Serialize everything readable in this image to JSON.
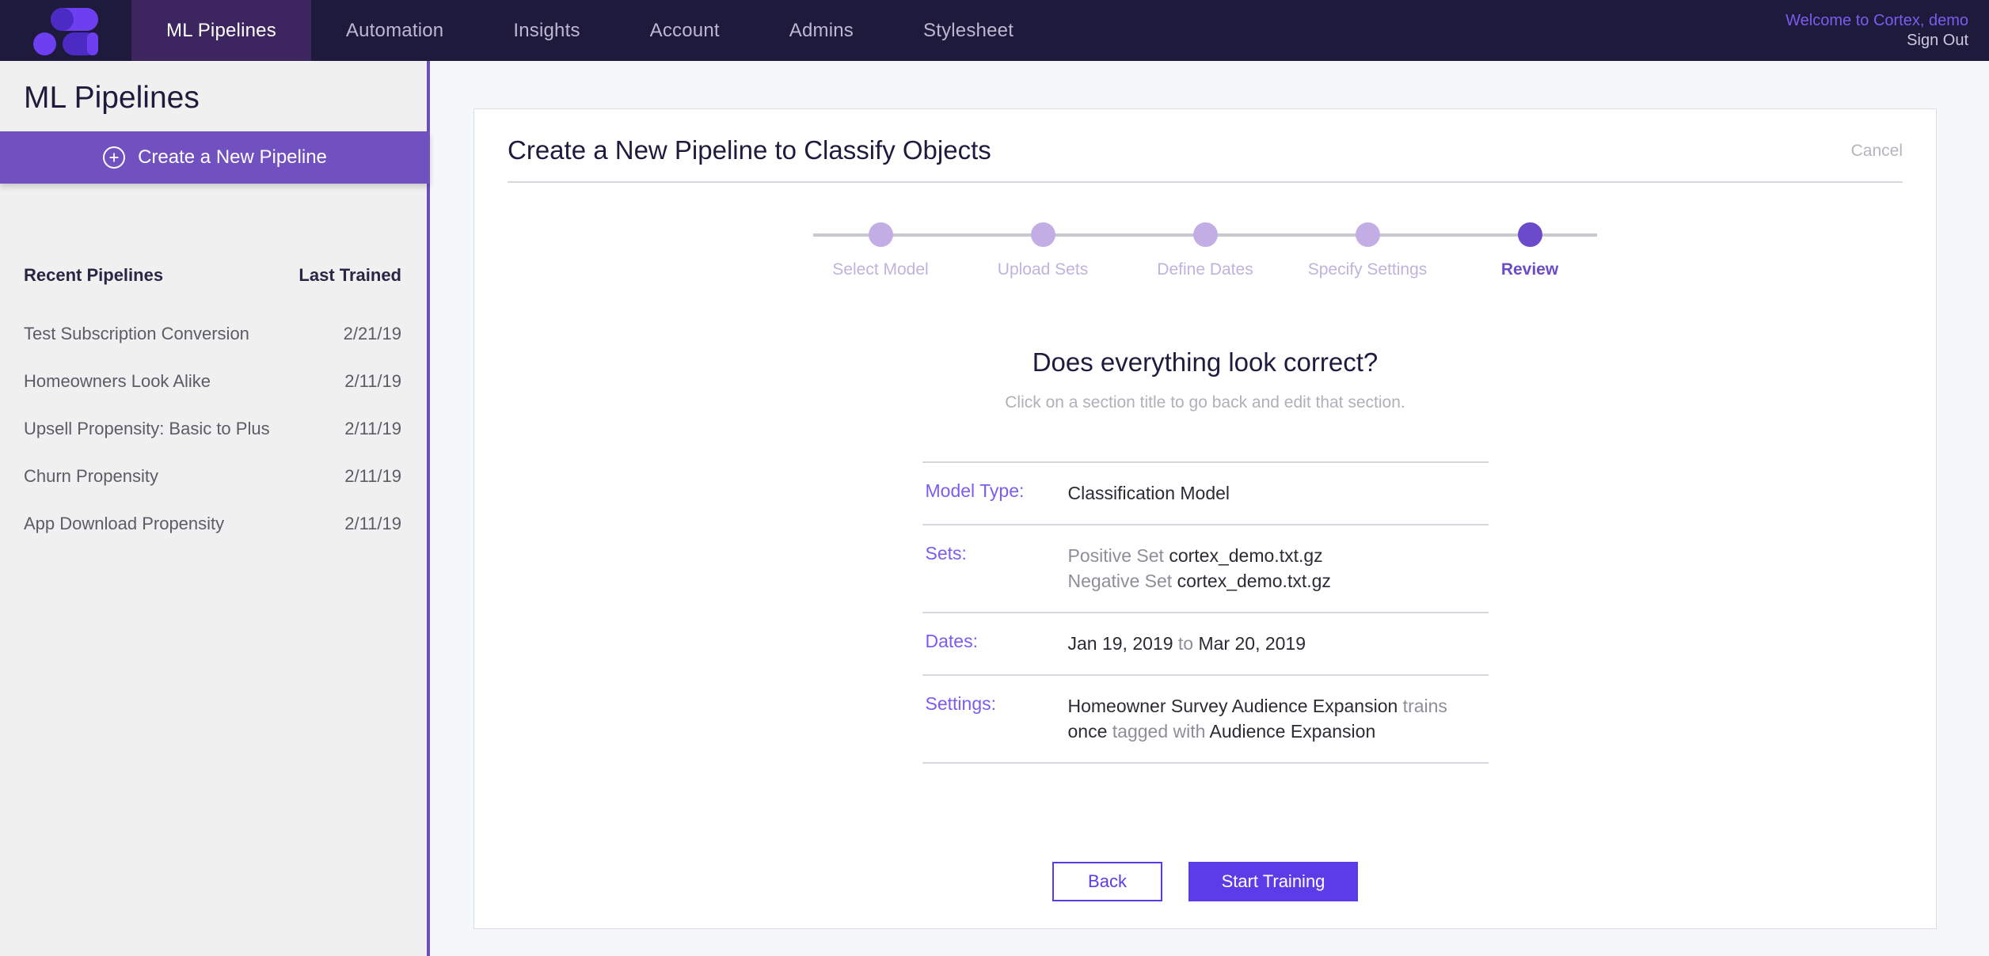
{
  "topnav": {
    "logo_name": "cortex-logo",
    "items": [
      {
        "label": "ML Pipelines",
        "active": true
      },
      {
        "label": "Automation",
        "active": false
      },
      {
        "label": "Insights",
        "active": false
      },
      {
        "label": "Account",
        "active": false
      },
      {
        "label": "Admins",
        "active": false
      },
      {
        "label": "Stylesheet",
        "active": false
      }
    ],
    "welcome": "Welcome to Cortex, demo",
    "sign_out": "Sign Out",
    "bg_color": "#1e1a3c",
    "active_bg_color": "#3d2560",
    "welcome_color": "#7b5cf0"
  },
  "sidebar": {
    "title": "ML Pipelines",
    "create_button": "Create a New Pipeline",
    "create_button_color": "#7150c0",
    "col_header_name": "Recent Pipelines",
    "col_header_date": "Last Trained",
    "pipelines": [
      {
        "name": "Test Subscription Conversion",
        "last_trained": "2/21/19"
      },
      {
        "name": "Homeowners Look Alike",
        "last_trained": "2/11/19"
      },
      {
        "name": "Upsell Propensity: Basic to Plus",
        "last_trained": "2/11/19"
      },
      {
        "name": "Churn Propensity",
        "last_trained": "2/11/19"
      },
      {
        "name": "App Download Propensity",
        "last_trained": "2/11/19"
      }
    ]
  },
  "card": {
    "title": "Create a New Pipeline to Classify Objects",
    "cancel": "Cancel",
    "stepper": [
      {
        "label": "Select Model",
        "active": false
      },
      {
        "label": "Upload Sets",
        "active": false
      },
      {
        "label": "Define Dates",
        "active": false
      },
      {
        "label": "Specify Settings",
        "active": false
      },
      {
        "label": "Review",
        "active": true
      }
    ],
    "stepper_active_color": "#6b4bc9",
    "stepper_inactive_color": "#c2aee4",
    "review_question": "Does everything look correct?",
    "review_subtitle": "Click on a section title to go back and edit that section.",
    "review_rows": {
      "model_type": {
        "key": "Model Type:",
        "value": "Classification Model"
      },
      "sets": {
        "key": "Sets:",
        "positive_prefix": "Positive Set ",
        "positive_file": "cortex_demo.txt.gz",
        "negative_prefix": "Negative Set ",
        "negative_file": "cortex_demo.txt.gz"
      },
      "dates": {
        "key": "Dates:",
        "start": "Jan 19, 2019",
        "separator": " to ",
        "end": "Mar 20, 2019"
      },
      "settings": {
        "key": "Settings:",
        "name": "Homeowner Survey Audience Expansion",
        "trains_label": " trains ",
        "frequency": "once",
        "tagged_label": " tagged with ",
        "tag": "Audience Expansion"
      }
    },
    "back_button": "Back",
    "start_button": "Start Training",
    "accent_color": "#5c3ce8",
    "label_color": "#7b5cf0"
  }
}
